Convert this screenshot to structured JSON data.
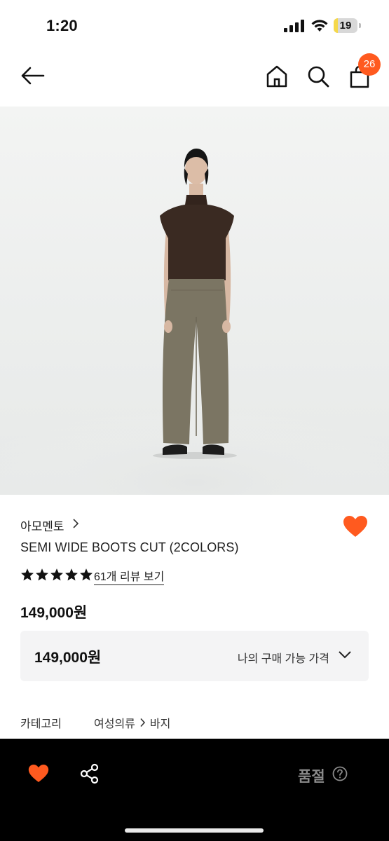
{
  "status_bar": {
    "time": "1:20",
    "battery": "19",
    "battery_level": 0.19
  },
  "nav": {
    "cart_count": "26"
  },
  "product": {
    "brand": "아모멘토",
    "title": "SEMI WIDE BOOTS CUT (2COLORS)",
    "rating_stars": 5,
    "review_link": "61개 리뷰 보기",
    "price": "149,000원",
    "my_price_value": "149,000원",
    "my_price_label": "나의 구매 가능 가격",
    "category_label": "카테고리",
    "category_path": [
      "여성의류",
      "바지"
    ]
  },
  "bottom_bar": {
    "status": "품절"
  },
  "colors": {
    "accent": "#ff5a1f",
    "bottom_bar": "#000000",
    "price_box": "#f4f4f5"
  },
  "icons": [
    "back-arrow-icon",
    "home-icon",
    "search-icon",
    "cart-icon",
    "heart-icon",
    "share-icon",
    "help-icon",
    "chevron-down-icon",
    "chevron-right-icon",
    "star-icon"
  ]
}
